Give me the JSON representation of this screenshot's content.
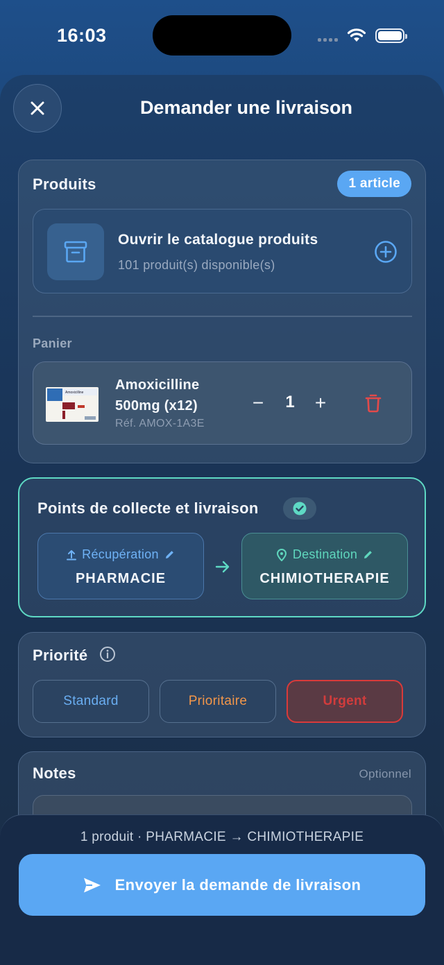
{
  "status_bar": {
    "time": "16:03"
  },
  "header": {
    "title": "Demander une livraison",
    "close_icon": "close-icon"
  },
  "produits": {
    "title": "Produits",
    "count_badge": "1 article",
    "catalog": {
      "title": "Ouvrir le catalogue produits",
      "subtitle": "101 produit(s) disponible(s)"
    },
    "panier_label": "Panier",
    "cart": [
      {
        "name": "Amoxicilline 500mg (x12)",
        "ref": "Réf. AMOX-1A3E",
        "quantity": "1",
        "minus": "−",
        "plus": "+"
      }
    ]
  },
  "points": {
    "title": "Points de collecte et livraison",
    "pickup_label": "Récupération",
    "pickup_value": "PHARMACIE",
    "destination_label": "Destination",
    "destination_value": "CHIMIOTHERAPIE"
  },
  "priorite": {
    "title": "Priorité",
    "options": [
      "Standard",
      "Prioritaire",
      "Urgent"
    ],
    "selected": "Urgent"
  },
  "notes": {
    "title": "Notes",
    "optional_label": "Optionnel"
  },
  "footer": {
    "summary": "1 produit · PHARMACIE → CHIMIOTHERAPIE",
    "send_label": "Envoyer la demande de livraison"
  },
  "colors": {
    "accent_blue": "#5aa7f3",
    "teal": "#5ed9c4",
    "urgent_red": "#d93a3a",
    "prioritaire_orange": "#f2964a"
  }
}
